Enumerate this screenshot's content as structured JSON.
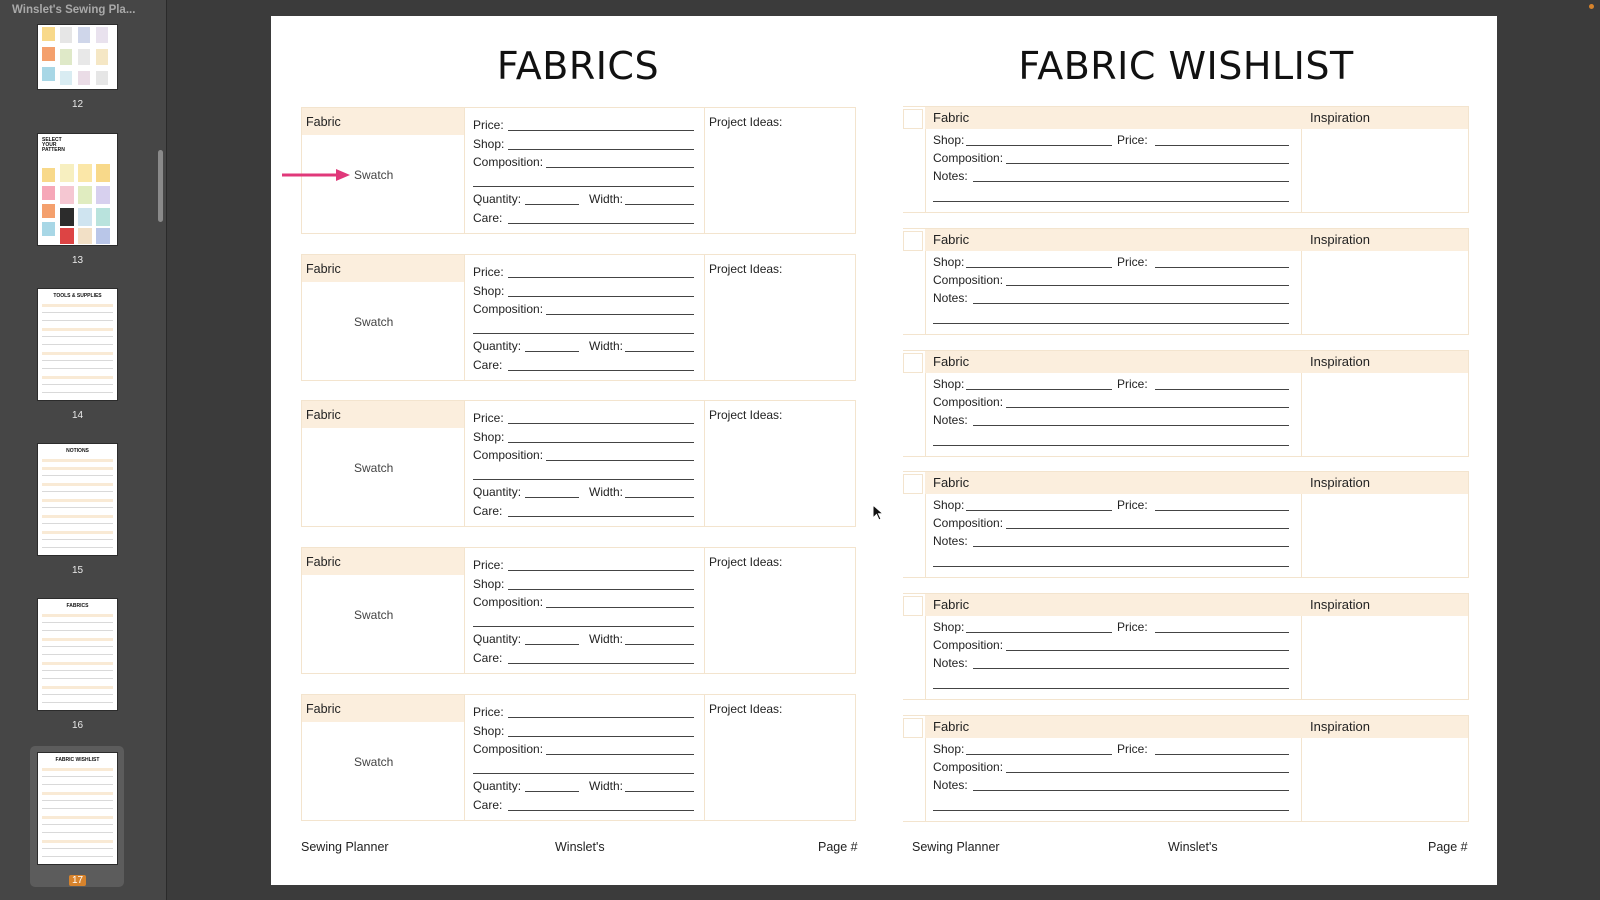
{
  "window": {
    "title": "Winslet's Sewing Pla..."
  },
  "sidebar": {
    "pages": [
      {
        "number": "12",
        "selected": false
      },
      {
        "number": "13",
        "selected": false,
        "heading": "SELECT YOUR PATTERN"
      },
      {
        "number": "14",
        "selected": false,
        "heading": "TOOLS & SUPPLIES"
      },
      {
        "number": "15",
        "selected": false,
        "heading": "NOTIONS"
      },
      {
        "number": "16",
        "selected": false,
        "heading": "FABRICS"
      },
      {
        "number": "17",
        "selected": true,
        "heading": "FABRIC WISHLIST"
      }
    ]
  },
  "left_page": {
    "title": "FABRICS",
    "block": {
      "fabric_label": "Fabric",
      "swatch_label": "Swatch",
      "price_label": "Price:",
      "shop_label": "Shop:",
      "composition_label": "Composition:",
      "quantity_label": "Quantity:",
      "width_label": "Width:",
      "care_label": "Care:",
      "project_ideas_label": "Project Ideas:"
    },
    "block_count": 5,
    "footer": {
      "left": "Sewing Planner",
      "center": "Winslet's",
      "right": "Page #"
    }
  },
  "right_page": {
    "title": "FABRIC WISHLIST",
    "block": {
      "fabric_label": "Fabric",
      "inspiration_label": "Inspiration",
      "shop_label": "Shop:",
      "price_label": "Price:",
      "composition_label": "Composition:",
      "notes_label": "Notes:"
    },
    "block_count": 6,
    "footer": {
      "left": "Sewing Planner",
      "center": "Winslet's",
      "right": "Page #"
    }
  },
  "colors": {
    "accent_tan": "#fbeedd",
    "arrow": "#e0387a",
    "selected_badge": "#d7832c"
  }
}
